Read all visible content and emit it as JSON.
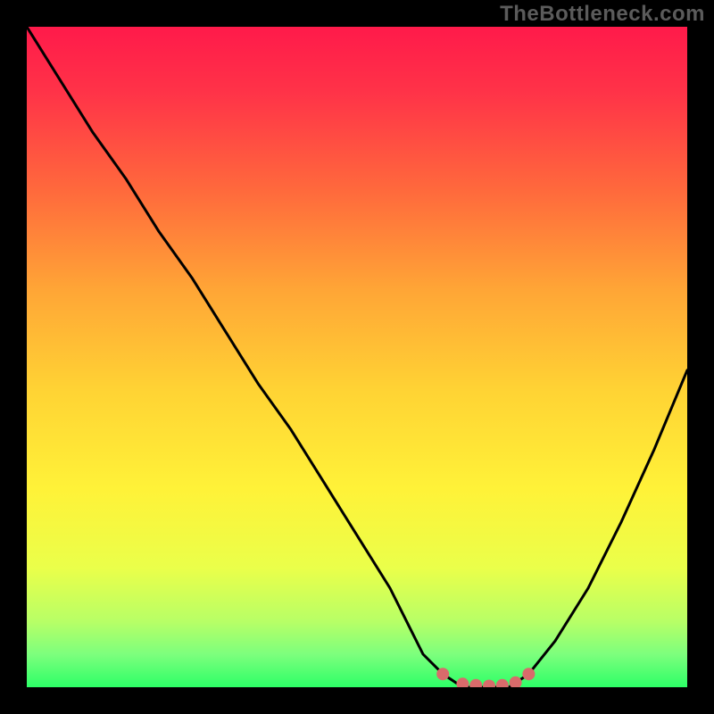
{
  "watermark": "TheBottleneck.com",
  "chart_data": {
    "type": "line",
    "title": "",
    "xlabel": "",
    "ylabel": "",
    "xlim": [
      0,
      100
    ],
    "ylim": [
      0,
      100
    ],
    "grid": false,
    "legend": false,
    "series": [
      {
        "name": "bottleneck-curve",
        "x": [
          0,
          5,
          10,
          15,
          20,
          25,
          30,
          35,
          40,
          45,
          50,
          55,
          58,
          60,
          63,
          66,
          70,
          73,
          76,
          80,
          85,
          90,
          95,
          100
        ],
        "y": [
          100,
          92,
          84,
          77,
          69,
          62,
          54,
          46,
          39,
          31,
          23,
          15,
          9,
          5,
          2,
          0,
          0,
          0,
          2,
          7,
          15,
          25,
          36,
          48
        ]
      }
    ],
    "markers": [
      {
        "name": "left-edge-marker",
        "x": 63,
        "y": 2
      },
      {
        "name": "right-edge-marker",
        "x": 76,
        "y": 2
      },
      {
        "name": "optimal-marker-1",
        "x": 66,
        "y": 0.5
      },
      {
        "name": "optimal-marker-2",
        "x": 68,
        "y": 0.3
      },
      {
        "name": "optimal-marker-3",
        "x": 70,
        "y": 0.2
      },
      {
        "name": "optimal-marker-4",
        "x": 72,
        "y": 0.3
      },
      {
        "name": "optimal-marker-5",
        "x": 74,
        "y": 0.7
      }
    ],
    "gradient_stops": [
      {
        "offset": 0.0,
        "color": "#ff1a4a"
      },
      {
        "offset": 0.1,
        "color": "#ff3348"
      },
      {
        "offset": 0.25,
        "color": "#ff6a3c"
      },
      {
        "offset": 0.4,
        "color": "#ffa636"
      },
      {
        "offset": 0.55,
        "color": "#ffd334"
      },
      {
        "offset": 0.7,
        "color": "#fff238"
      },
      {
        "offset": 0.82,
        "color": "#eaff4a"
      },
      {
        "offset": 0.9,
        "color": "#b8ff66"
      },
      {
        "offset": 0.95,
        "color": "#7dff7d"
      },
      {
        "offset": 1.0,
        "color": "#2dff67"
      }
    ],
    "marker_color": "#d86b6b",
    "curve_color": "#000000"
  }
}
